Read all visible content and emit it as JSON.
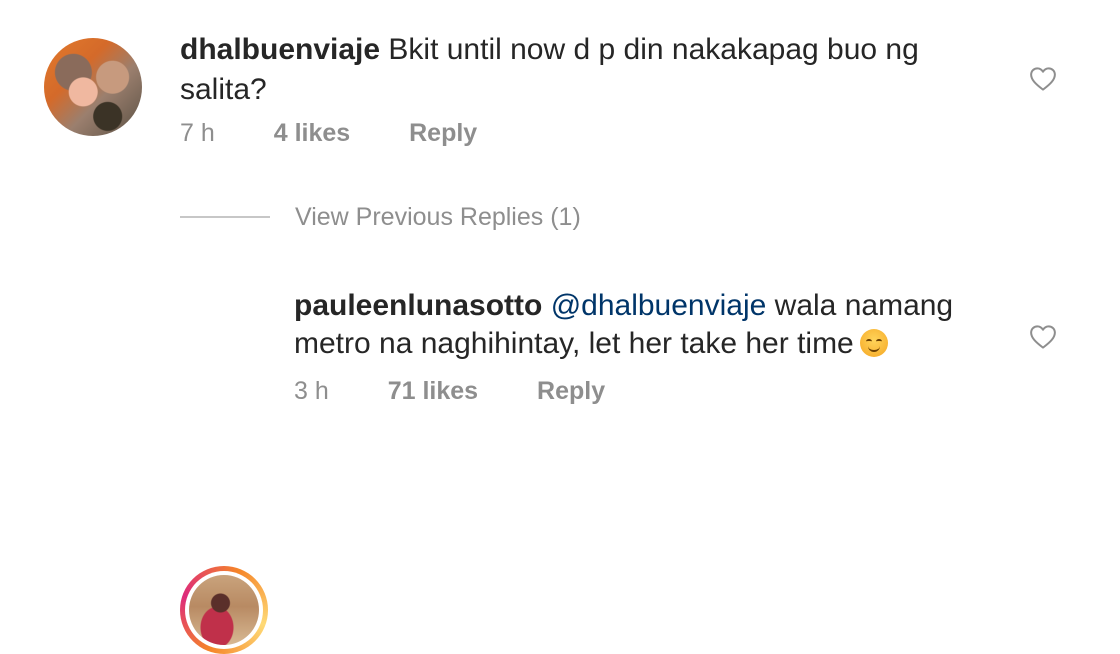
{
  "comments": [
    {
      "username": "dhalbuenviaje",
      "text_line1": "Bkit until now d p din nakakapag buo ng",
      "text_line2": "salita?",
      "time": "7 h",
      "likes": "4 likes",
      "reply": "Reply"
    },
    {
      "username": "pauleenlunasotto",
      "mention": "@dhalbuenviaje",
      "text_line1_rest": "wala namang",
      "text_line2": "metro na naghihintay, let her take her time",
      "emoji": "smiling-face-emoji",
      "time": "3 h",
      "likes": "71 likes",
      "reply": "Reply"
    }
  ],
  "view_previous_replies": "View Previous Replies (1)",
  "colors": {
    "text": "#262626",
    "meta": "#8e8e8e",
    "mention": "#003569",
    "divider": "#c7c7c7",
    "story_ring": [
      "#f58529",
      "#dd2a7b",
      "#feda77"
    ]
  },
  "icons": {
    "like": "heart-outline-icon"
  }
}
